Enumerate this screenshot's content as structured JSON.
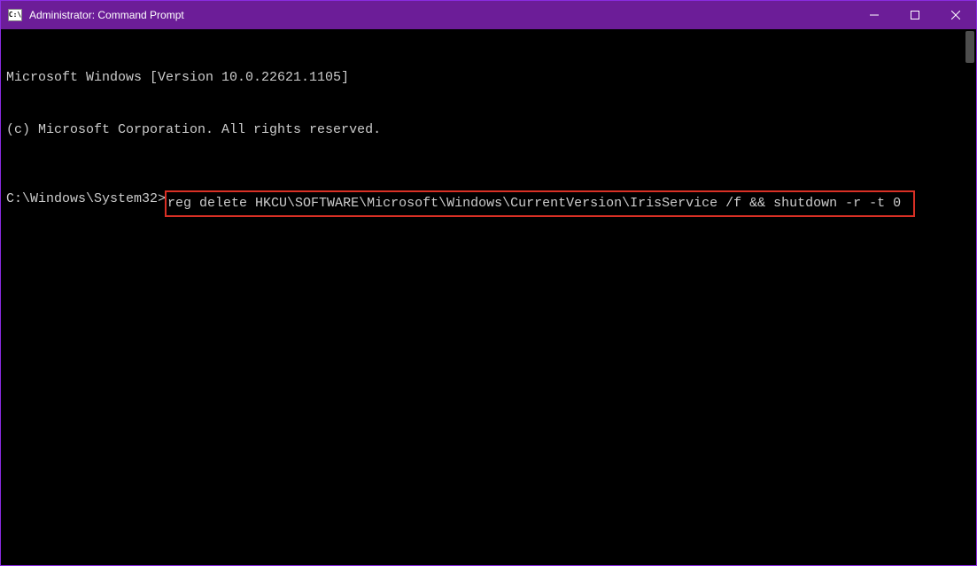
{
  "titlebar": {
    "icon_text": "C:\\",
    "title": "Administrator: Command Prompt"
  },
  "window_controls": {
    "minimize": "minimize",
    "maximize": "maximize",
    "close": "close"
  },
  "terminal": {
    "line1": "Microsoft Windows [Version 10.0.22621.1105]",
    "line2": "(c) Microsoft Corporation. All rights reserved.",
    "prompt": "C:\\Windows\\System32>",
    "command": "reg delete HKCU\\SOFTWARE\\Microsoft\\Windows\\CurrentVersion\\IrisService /f && shutdown -r -t 0 "
  }
}
